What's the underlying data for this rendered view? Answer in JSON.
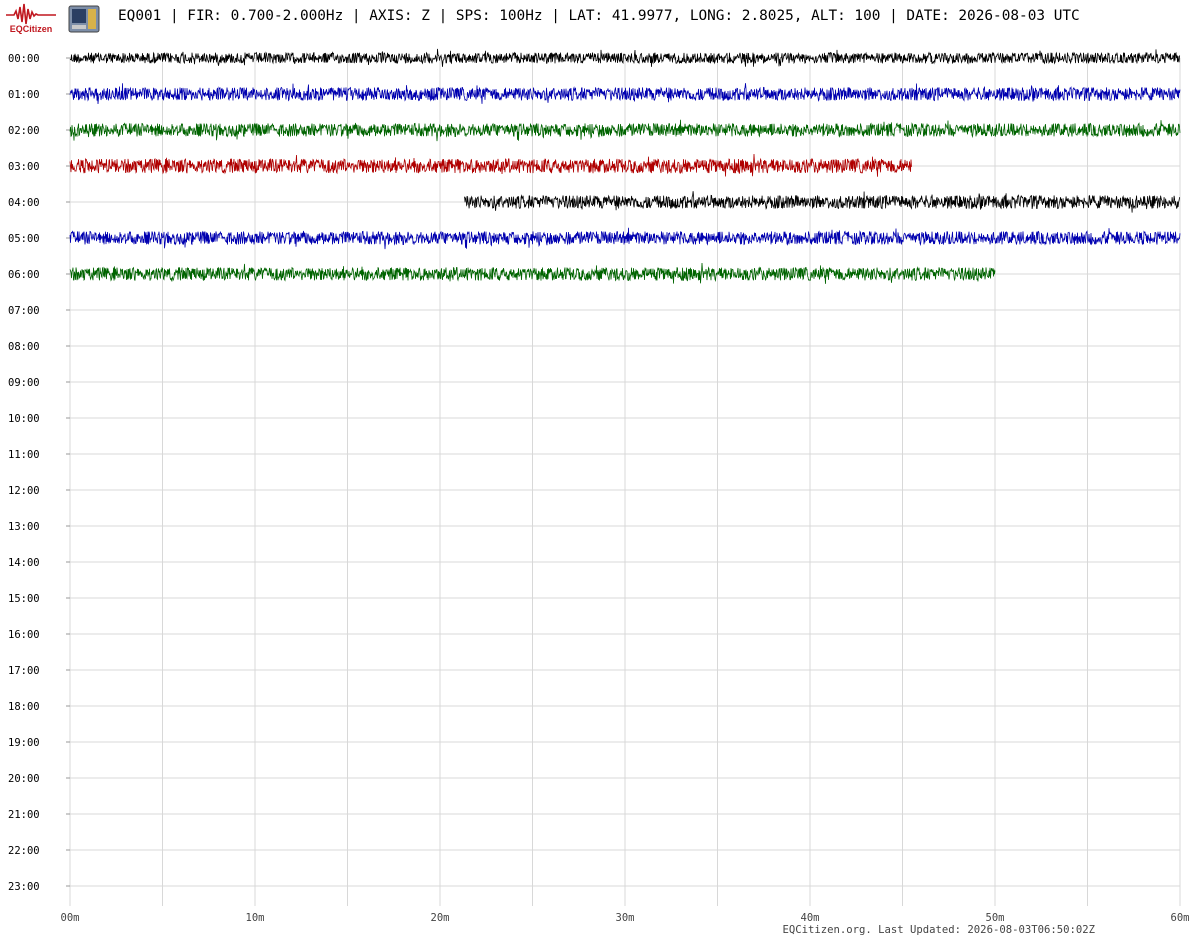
{
  "logo": {
    "text": "EQCitizen",
    "color": "#c0171f"
  },
  "header": {
    "station": "EQ001",
    "fir": "FIR: 0.700-2.000Hz",
    "axis": "AXIS: Z",
    "sps": "SPS: 100Hz",
    "location": "LAT: 41.9977, LONG: 2.8025, ALT: 100",
    "date": "DATE: 2026-08-03 UTC",
    "full": "EQ001 | FIR: 0.700-2.000Hz | AXIS: Z | SPS: 100Hz | LAT: 41.9977, LONG: 2.8025, ALT: 100 | DATE: 2026-08-03 UTC"
  },
  "footer": {
    "text": "EQCitizen.org. Last Updated: 2026-08-03T06:50:02Z"
  },
  "chart_data": {
    "type": "line",
    "title": "",
    "xlabel": "",
    "ylabel": "",
    "x_range_minutes": [
      0,
      60
    ],
    "x_ticks": [
      "00m",
      "10m",
      "20m",
      "30m",
      "40m",
      "50m",
      "60m"
    ],
    "x_minor_step_minutes": 5,
    "rows": [
      "00:00",
      "01:00",
      "02:00",
      "03:00",
      "04:00",
      "05:00",
      "06:00",
      "07:00",
      "08:00",
      "09:00",
      "10:00",
      "11:00",
      "12:00",
      "13:00",
      "14:00",
      "15:00",
      "16:00",
      "17:00",
      "18:00",
      "19:00",
      "20:00",
      "21:00",
      "22:00",
      "23:00"
    ],
    "grid": true,
    "traces": [
      {
        "hour": "00:00",
        "start_min": 0,
        "end_min": 60,
        "color": "#000000",
        "amplitude": 0.45
      },
      {
        "hour": "01:00",
        "start_min": 0,
        "end_min": 60,
        "color": "#0000b0",
        "amplitude": 0.55
      },
      {
        "hour": "02:00",
        "start_min": 0,
        "end_min": 60,
        "color": "#006400",
        "amplitude": 0.55
      },
      {
        "hour": "03:00",
        "start_min": 0,
        "end_min": 45.5,
        "color": "#b00000",
        "amplitude": 0.6
      },
      {
        "hour": "04:00",
        "start_min": 21.3,
        "end_min": 60,
        "color": "#000000",
        "amplitude": 0.55
      },
      {
        "hour": "05:00",
        "start_min": 0,
        "end_min": 60,
        "color": "#0000b0",
        "amplitude": 0.55
      },
      {
        "hour": "06:00",
        "start_min": 0,
        "end_min": 50,
        "color": "#006400",
        "amplitude": 0.55
      }
    ]
  }
}
